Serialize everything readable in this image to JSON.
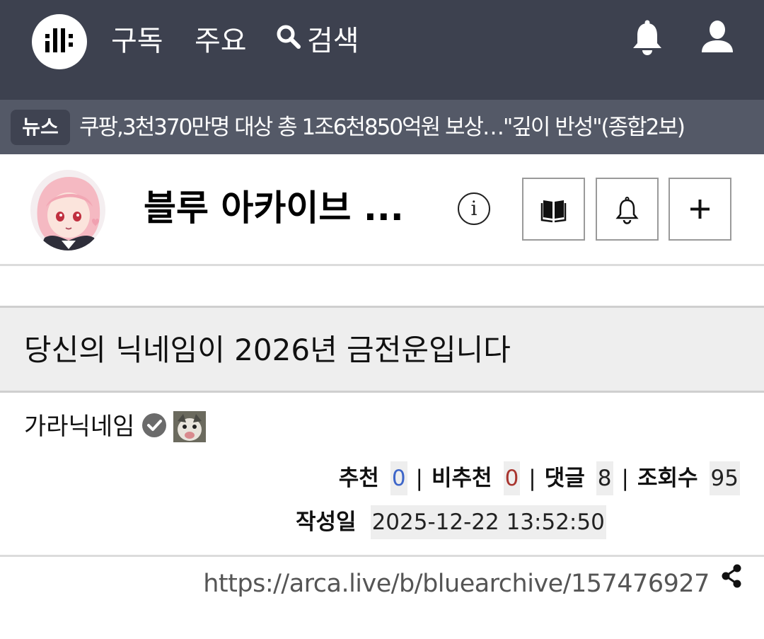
{
  "nav": {
    "items": [
      "구독",
      "주요"
    ],
    "search_label": "검색"
  },
  "news": {
    "badge": "뉴스",
    "headline": "쿠팡,3천370만명 대상 총 1조6천850억원 보상…\"깊이 반성\"(종합2보)"
  },
  "board": {
    "title": "블루 아카이브 ...",
    "info_glyph": "i"
  },
  "article": {
    "title": "당신의 닉네임이 2026년 금전운입니다",
    "author": "가라닉네임",
    "stats": {
      "upvote_label": "추천",
      "upvote_value": "0",
      "downvote_label": "비추천",
      "downvote_value": "0",
      "comments_label": "댓글",
      "comments_value": "8",
      "views_label": "조회수",
      "views_value": "95",
      "separator": "|"
    },
    "date_label": "작성일",
    "date_value": "2025-12-22 13:52:50",
    "url": "https://arca.live/b/bluearchive/157476927"
  },
  "colors": {
    "topbar": "#3d414f",
    "newsbar": "#545967",
    "upvote": "#3e66c9",
    "downvote": "#a8352f"
  },
  "icons": {
    "logo": "site-logo-icon",
    "search": "search-icon",
    "notifications": "bell-icon",
    "profile": "user-icon",
    "info": "info-icon",
    "book": "book-icon",
    "subscribe_alert": "bell-outline-icon",
    "add": "plus-icon",
    "verified": "check-badge-icon",
    "share": "share-icon"
  }
}
